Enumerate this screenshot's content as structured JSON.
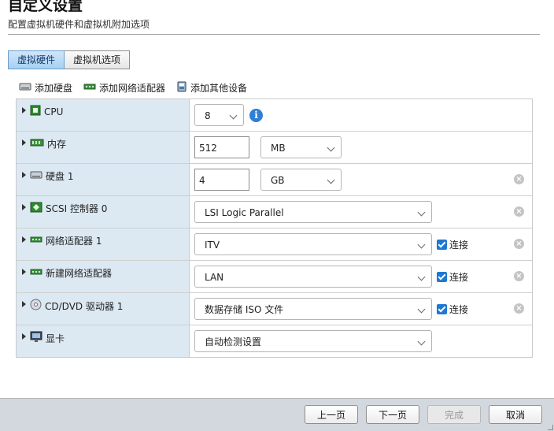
{
  "header": {
    "title": "自定义设置",
    "subtitle": "配置虚拟机硬件和虚拟机附加选项"
  },
  "tabs": [
    {
      "label": "虚拟硬件",
      "active": true
    },
    {
      "label": "虚拟机选项",
      "active": false
    }
  ],
  "add_bar": {
    "add_disk": "添加硬盘",
    "add_nic": "添加网络适配器",
    "add_other": "添加其他设备"
  },
  "devices": {
    "cpu": {
      "label": "CPU",
      "value": "8"
    },
    "memory": {
      "label": "内存",
      "value": "512",
      "unit": "MB"
    },
    "disk1": {
      "label": "硬盘 1",
      "value": "4",
      "unit": "GB"
    },
    "scsi": {
      "label": "SCSI 控制器 0",
      "value": "LSI Logic Parallel"
    },
    "nic1": {
      "label": "网络适配器 1",
      "value": "ITV",
      "connect_label": "连接",
      "connected": true
    },
    "new_nic": {
      "label": "新建网络适配器",
      "value": "LAN",
      "connect_label": "连接",
      "connected": true
    },
    "cdrom": {
      "label": "CD/DVD 驱动器 1",
      "value": "数据存储 ISO 文件",
      "connect_label": "连接",
      "connected": true
    },
    "video": {
      "label": "显卡",
      "value": "自动检测设置"
    }
  },
  "footer": {
    "back": "上一页",
    "next": "下一页",
    "finish": "完成",
    "cancel": "取消"
  },
  "colors": {
    "left_column_bg": "#dce9f3",
    "active_tab_bg": "#a8d0f3",
    "checkbox": "#1f78d1",
    "footer_bg": "#d3d8de"
  }
}
